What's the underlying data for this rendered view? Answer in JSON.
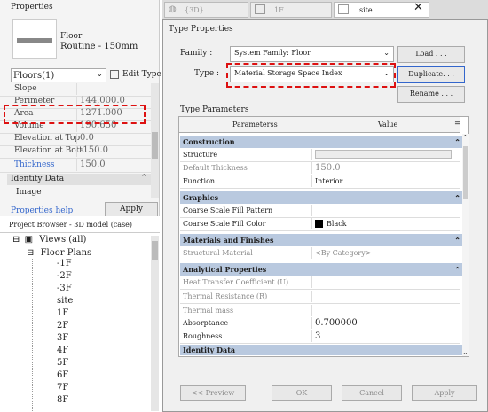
{
  "left": {
    "title": "Properties",
    "type_name": "Floor",
    "type_sub": "Routine - 150mm",
    "selector": "Floors(1)",
    "edit_type": "Edit Type",
    "rows": [
      {
        "k": "Slope",
        "v": ""
      },
      {
        "k": "Perimeter",
        "v": "144,000.0"
      },
      {
        "k": "Area",
        "v": "1271.000"
      },
      {
        "k": "Volume",
        "v": "190.650"
      },
      {
        "k": "Elevation at Top",
        "v": "0.0"
      },
      {
        "k": "Elevation at Bott...",
        "v": "-150.0"
      },
      {
        "k": "Thickness",
        "v": "150.0"
      }
    ],
    "identity": "Identity Data",
    "image_label": "Image",
    "help": "Properties help",
    "apply": "Apply"
  },
  "browser": {
    "title": "Project Browser - 3D model (case)",
    "views": "Views (all)",
    "floor_plans": "Floor Plans",
    "plans": [
      "-1F",
      "-2F",
      "-3F",
      "site",
      "1F",
      "2F",
      "3F",
      "4F",
      "5F",
      "6F",
      "7F",
      "8F"
    ]
  },
  "tabs": [
    "{3D}",
    "1F",
    "site"
  ],
  "dialog": {
    "title": "Type Properties",
    "family_label": "Family :",
    "family_value": "System Family: Floor",
    "type_label": "Type :",
    "type_value": "Material Storage Space Index",
    "load": "Load . . .",
    "duplicate": "Duplicate. . .",
    "rename": "Rename . . .",
    "type_params": "Type Parameters",
    "col_param": "Parameterss",
    "col_value": "Value",
    "col_eq": "=",
    "groups": {
      "construction": "Construction",
      "graphics": "Graphics",
      "materials": "Materials and Finishes",
      "analytical": "Analytical Properties",
      "identity": "Identity Data"
    },
    "rows": {
      "structure": "Structure",
      "default_thickness": "Default Thickness",
      "default_thickness_v": "150.0",
      "function": "Function",
      "function_v": "Interior",
      "coarse_pattern": "Coarse Scale Fill Pattern",
      "coarse_color": "Coarse Scale Fill Color",
      "coarse_color_v": "Black",
      "struct_mat": "Structural Material",
      "struct_mat_v": "<By Category>",
      "htc": "Heat Transfer Coefficient (U)",
      "thermal_res": "Thermal Resistance (R)",
      "thermal_mass": "Thermal mass",
      "absorptance": "Absorptance",
      "absorptance_v": "0.700000",
      "roughness": "Roughness",
      "roughness_v": "3"
    },
    "preview": "<< Preview",
    "ok": "OK",
    "cancel": "Cancel",
    "apply": "Apply"
  }
}
